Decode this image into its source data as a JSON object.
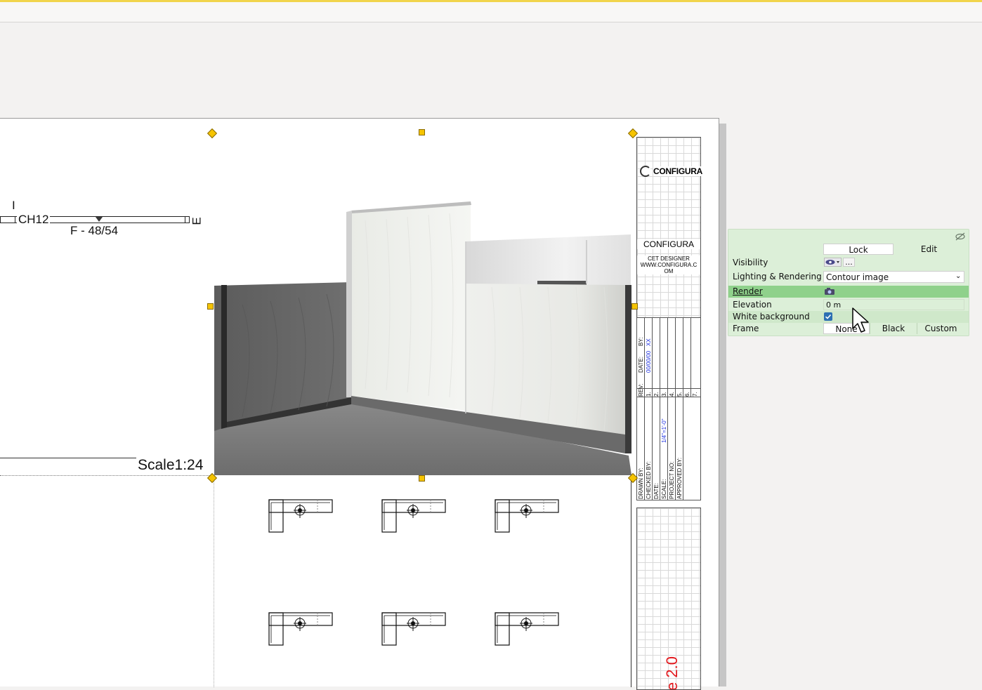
{
  "plan": {
    "label_i": "I",
    "label_e": "E",
    "code": "CH12",
    "dimension": "F - 48/54",
    "scale": "Scale1:24"
  },
  "title_block": {
    "logo": "CONFIGURA",
    "company": "CONFIGURA",
    "sub1": "CET DESIGNER",
    "sub2": "WWW.CONFIGURA.C",
    "sub3": "OM",
    "rev_headers": {
      "rev": "REV:",
      "date": "DATE:",
      "by": "BY:"
    },
    "rev_date": "00/00/00",
    "rev_by": "XX",
    "rev_rows": [
      "1.",
      "2.",
      "3.",
      "4.",
      "5.",
      "6.",
      "7."
    ],
    "drawn_by": "DRAWN BY:",
    "checked_by": "CHECKED BY:",
    "date": "DATE:",
    "scale": "SCALE:",
    "scale_value": "1/4\"=1'-0\"",
    "project_no": "PROJECT NO:",
    "approved_by": "APPROVED BY:",
    "version_fragment": "e 2.0"
  },
  "panel": {
    "lock_label": "Lock",
    "edit_label": "Edit",
    "visibility_label": "Visibility",
    "visibility_more": "...",
    "lighting_label": "Lighting & Rendering",
    "lighting_value": "Contour image",
    "render_label": "Render",
    "elevation_label": "Elevation",
    "elevation_value": "0 m",
    "white_bg_label": "White background",
    "white_bg_checked": true,
    "frame_label": "Frame",
    "frame_options": [
      "None",
      "Black",
      "Custom"
    ],
    "frame_selected": "None"
  },
  "colors": {
    "accent": "#f1d44c",
    "panel_bg": "#dcefd8",
    "panel_highlight": "#8fd18b",
    "handle": "#f6c400",
    "rev_blue": "#1c2fe0",
    "version_red": "#e3171c"
  }
}
